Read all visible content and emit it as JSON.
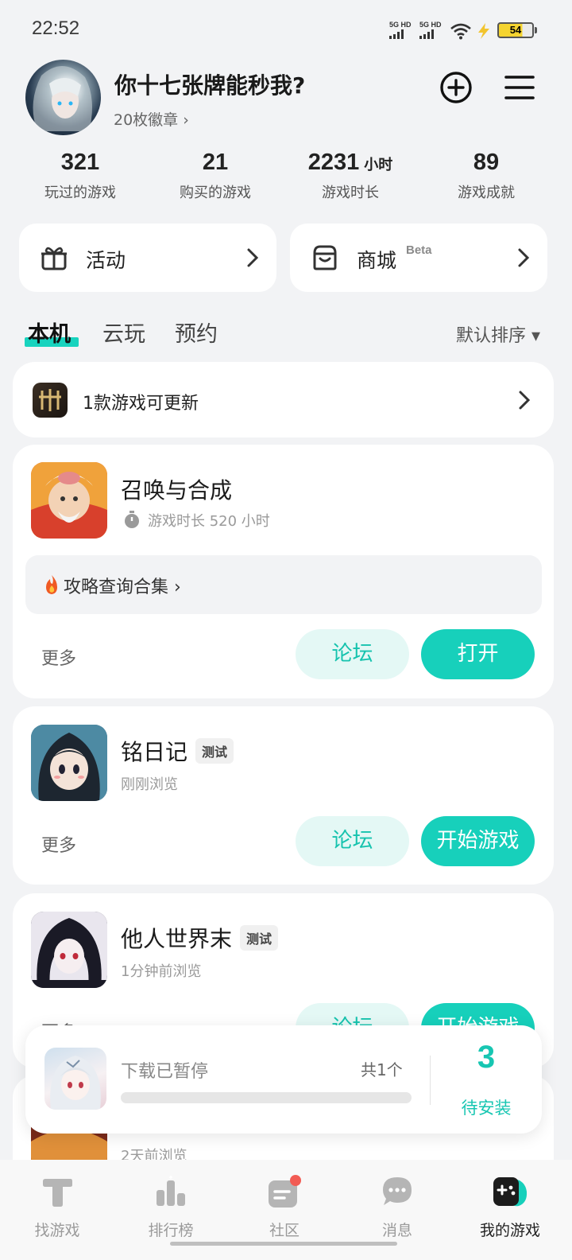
{
  "status_bar": {
    "time": "22:52",
    "signal_1": "5G HD",
    "signal_2": "5G HD",
    "battery": "54",
    "icons": [
      "signal-icon",
      "wifi-icon",
      "charging-icon",
      "battery-icon"
    ]
  },
  "profile": {
    "username": "你十七张牌能秒我?",
    "badges": "20枚徽章 ›"
  },
  "stats": [
    {
      "value": "321",
      "unit": "",
      "label": "玩过的游戏"
    },
    {
      "value": "21",
      "unit": "",
      "label": "购买的游戏"
    },
    {
      "value": "2231",
      "unit": "小时",
      "label": "游戏时长"
    },
    {
      "value": "89",
      "unit": "",
      "label": "游戏成就"
    }
  ],
  "quick": {
    "activity": "活动",
    "store": "商城",
    "store_badge": "Beta"
  },
  "tabs": [
    "本机",
    "云玩",
    "预约"
  ],
  "sort": "默认排序 ▾",
  "update_banner": "1款游戏可更新",
  "games": [
    {
      "title": "召唤与合成",
      "tag": "",
      "sub": "游戏时长 520 小时",
      "strategy": "攻略查询合集 ›",
      "more": "更多",
      "forum": "论坛",
      "action": "打开"
    },
    {
      "title": "铭日记",
      "tag": "测试",
      "sub": "刚刚浏览",
      "more": "更多",
      "forum": "论坛",
      "action": "开始游戏"
    },
    {
      "title": "他人世界末",
      "tag": "测试",
      "sub": "1分钟前浏览",
      "more": "更多",
      "forum": "论坛",
      "action": "开始游戏"
    },
    {
      "sub": "2天前浏览"
    }
  ],
  "download": {
    "status": "下载已暂停",
    "count": "共1个",
    "pending_count": "3",
    "pending_label": "待安装"
  },
  "nav": [
    {
      "label": "找游戏"
    },
    {
      "label": "排行榜"
    },
    {
      "label": "社区"
    },
    {
      "label": "消息"
    },
    {
      "label": "我的游戏"
    }
  ],
  "colors": {
    "accent": "#17d0bb",
    "accent_light": "#e4f8f5",
    "notification": "#f25c54"
  }
}
